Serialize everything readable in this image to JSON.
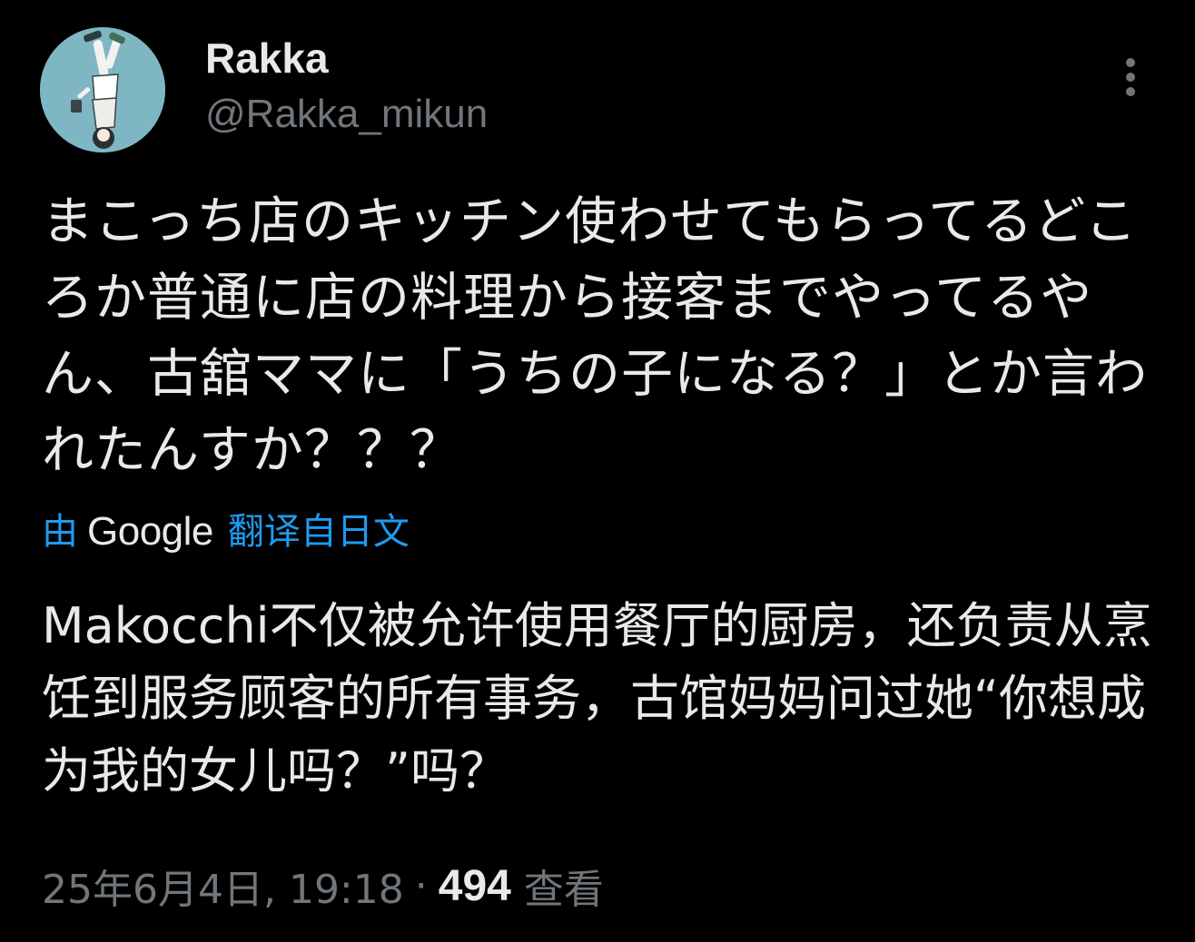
{
  "author": {
    "display_name": "Rakka",
    "handle": "@Rakka_mikun",
    "avatar_icon": "anime-character-avatar"
  },
  "more_icon": "more-vertical-icon",
  "tweet": {
    "text": "まこっち店のキッチン使わせてもらってるどころか普通に店の料理から接客までやってるやん、古舘ママに「うちの子になる？」とか言われたんすか？？？"
  },
  "translation": {
    "prefix": "由",
    "provider": "Google",
    "suffix": "翻译自日文",
    "text": "Makocchi不仅被允许使用餐厅的厨房，还负责从烹饪到服务顾客的所有事务，古馆妈妈问过她“你想成为我的女儿吗？”吗？"
  },
  "meta": {
    "timestamp": "25年6月4日, 19:18",
    "separator": "·",
    "views_count": "494",
    "views_label": "查看"
  },
  "colors": {
    "background": "#000000",
    "primary_text": "#e7e9ea",
    "secondary_text": "#71767b",
    "link": "#1d9bf0",
    "avatar_bg": "#7fb6c4"
  }
}
